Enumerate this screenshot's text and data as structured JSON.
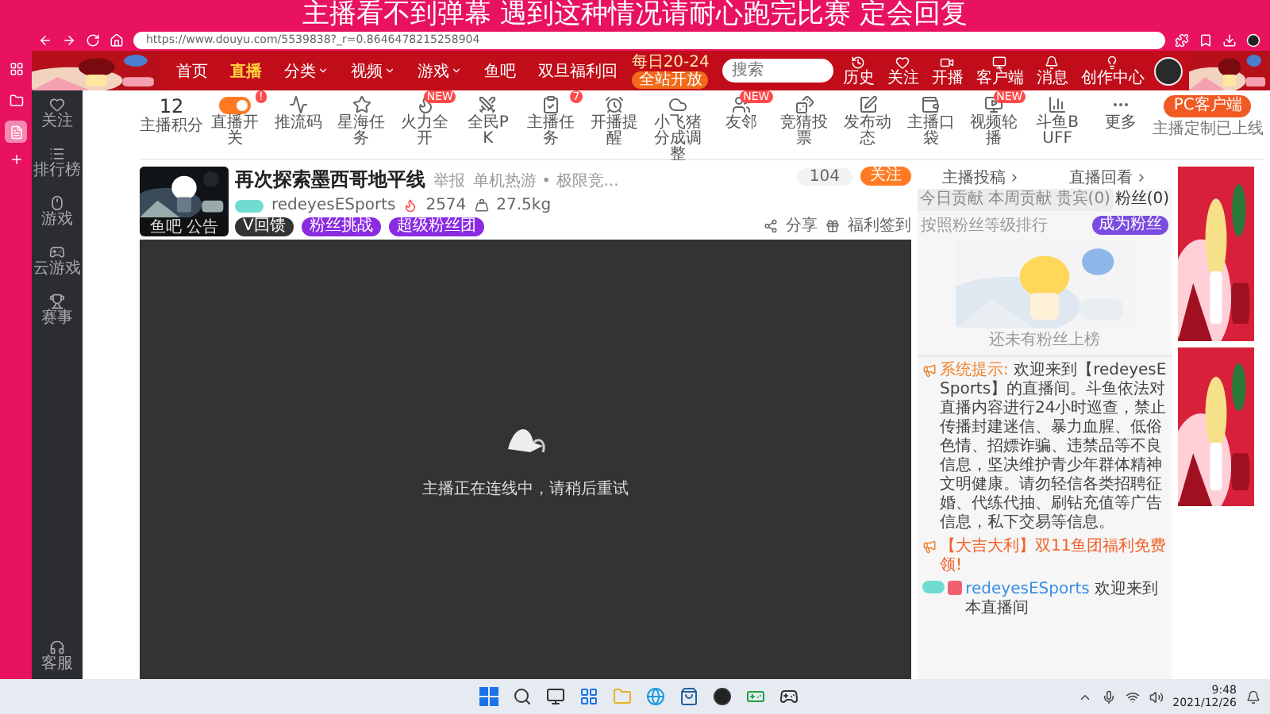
{
  "caption": "主播看不到弹幕 遇到这种情况请耐心跑完比赛 定会回复",
  "browser": {
    "url": "https://www.douyu.com/5539838?_r=0.8646478215258904"
  },
  "header": {
    "nav": [
      {
        "label": "首页",
        "selected": false,
        "dropdown": false
      },
      {
        "label": "直播",
        "selected": true,
        "dropdown": false
      },
      {
        "label": "分类",
        "selected": false,
        "dropdown": true
      },
      {
        "label": "视频",
        "selected": false,
        "dropdown": true
      },
      {
        "label": "游戏",
        "selected": false,
        "dropdown": true
      },
      {
        "label": "鱼吧",
        "selected": false,
        "dropdown": false
      },
      {
        "label": "双旦福利回",
        "selected": false,
        "dropdown": false
      }
    ],
    "promo": {
      "date": "每日20-24",
      "label": "全站开放"
    },
    "search": {
      "placeholder": "搜索"
    },
    "actions": [
      "历史",
      "关注",
      "开播",
      "客户端",
      "消息",
      "创作中心"
    ]
  },
  "sidebar": [
    "关注",
    "排行榜",
    "游戏",
    "云游戏",
    "赛事",
    "客服"
  ],
  "toolbar": {
    "score": {
      "value": "12",
      "label": "主播积分"
    },
    "items": [
      {
        "label": "直播开关",
        "kind": "toggle",
        "on": true,
        "badge": "!"
      },
      {
        "label": "推流码",
        "kind": "icon"
      },
      {
        "label": "星海任务",
        "kind": "icon"
      },
      {
        "label": "火力全开",
        "kind": "icon",
        "badge": "NEW"
      },
      {
        "label": "全民PK",
        "kind": "icon"
      },
      {
        "label": "主播任务",
        "kind": "icon",
        "badge": "7"
      },
      {
        "label": "开播提醒",
        "kind": "icon"
      },
      {
        "label": "小飞猪分成调整",
        "kind": "icon"
      },
      {
        "label": "友邻",
        "kind": "icon",
        "badge": "NEW"
      },
      {
        "label": "竞猜投票",
        "kind": "icon"
      },
      {
        "label": "发布动态",
        "kind": "icon"
      },
      {
        "label": "主播口袋",
        "kind": "icon"
      },
      {
        "label": "视频轮播",
        "kind": "icon",
        "badge": "NEW"
      },
      {
        "label": "斗鱼BUFF",
        "kind": "icon"
      },
      {
        "label": "更多",
        "kind": "icon"
      }
    ],
    "client_button": "PC客户端",
    "client_note": "主播定制已上线"
  },
  "stream": {
    "title": "再次探索墨西哥地平线",
    "report": "举报",
    "category": "单机热游 • 极限竞...",
    "streamer": "redeyesESports",
    "heat": "2574",
    "weight": "27.5kg",
    "badges": [
      "V回馈",
      "粉丝挑战",
      "超级粉丝团"
    ],
    "avatar_links": [
      "鱼吧",
      "公告"
    ],
    "followers": "104",
    "follow": "关注",
    "share": "分享",
    "checkin": "福利签到"
  },
  "video": {
    "status": "主播正在连线中，请稍后重试"
  },
  "chat": {
    "links": [
      "主播投稿",
      "直播回看"
    ],
    "tabs": [
      {
        "label": "今日贡献",
        "selected": false
      },
      {
        "label": "本周贡献",
        "selected": false
      },
      {
        "label": "贵宾(0)",
        "selected": false
      },
      {
        "label": "粉丝(0)",
        "selected": true
      }
    ],
    "rank_note": "按照粉丝等级排行",
    "join": "成为粉丝",
    "empty": "还未有粉丝上榜",
    "messages": [
      {
        "kind": "system",
        "prefix": "系统提示:",
        "text": "欢迎来到【redeyesESports】的直播间。斗鱼依法对直播内容进行24小时巡查，禁止传播封建迷信、暴力血腥、低俗色情、招嫖诈骗、违禁品等不良信息，坚决维护青少年群体精神文明健康。请勿轻信各类招聘征婚、代练代抽、刷钻充值等广告信息，私下交易等信息。"
      },
      {
        "kind": "notice",
        "text": "【大吉大利】双11鱼团福利免费领!"
      },
      {
        "kind": "user",
        "user": "redeyesESports",
        "text": "欢迎来到本直播间"
      }
    ]
  },
  "taskbar": {
    "time": "9:48",
    "date": "2021/12/26"
  }
}
